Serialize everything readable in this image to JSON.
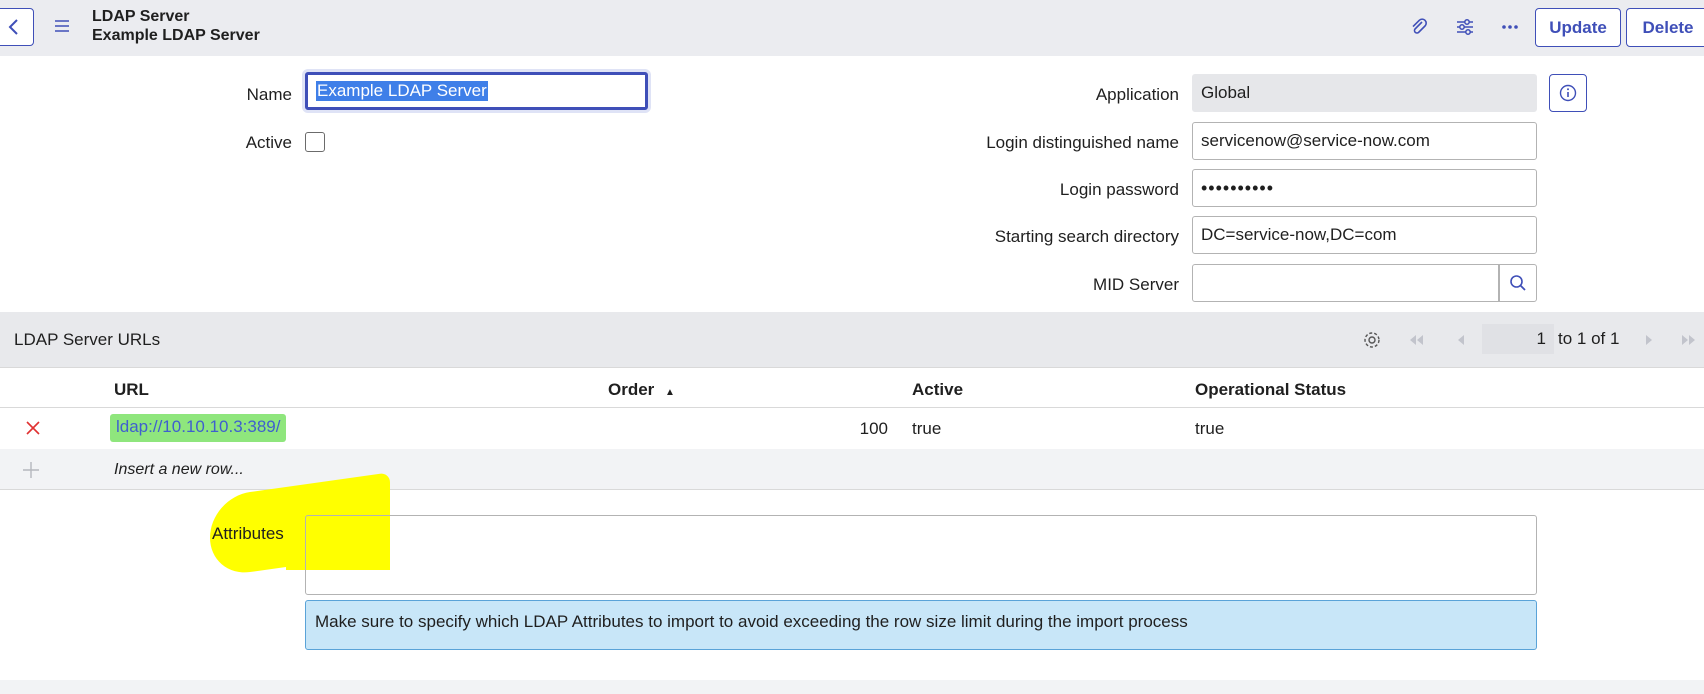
{
  "header": {
    "title_line1": "LDAP Server",
    "title_line2": "Example LDAP Server",
    "update_label": "Update",
    "delete_label": "Delete"
  },
  "form": {
    "name_label": "Name",
    "name_value": "Example LDAP Server",
    "active_label": "Active",
    "active_checked": false,
    "application_label": "Application",
    "application_value": "Global",
    "login_dn_label": "Login distinguished name",
    "login_dn_value": "servicenow@service-now.com",
    "login_password_label": "Login password",
    "login_password_value": "••••••••••",
    "starting_dir_label": "Starting search directory",
    "starting_dir_value": "DC=service-now,DC=com",
    "mid_server_label": "MID Server",
    "mid_server_value": ""
  },
  "related_list": {
    "title": "LDAP Server URLs",
    "page_current": "1",
    "page_range": "to 1 of 1",
    "columns": [
      "URL",
      "Order",
      "Active",
      "Operational Status"
    ],
    "rows": [
      {
        "url": "ldap://10.10.10.3:389/",
        "order": "100",
        "active": "true",
        "operational_status": "true"
      }
    ],
    "insert_label": "Insert a new row..."
  },
  "attributes": {
    "label": "Attributes",
    "value": "",
    "message": "Make sure to specify which LDAP Attributes to import to avoid exceeding the row size limit during the import process"
  },
  "colors": {
    "accent": "#3f4fb8",
    "highlight": "#ffff00",
    "url_highlight": "#8fe67d",
    "info_bg": "#c8e6f8",
    "delete_x": "#e03131"
  }
}
